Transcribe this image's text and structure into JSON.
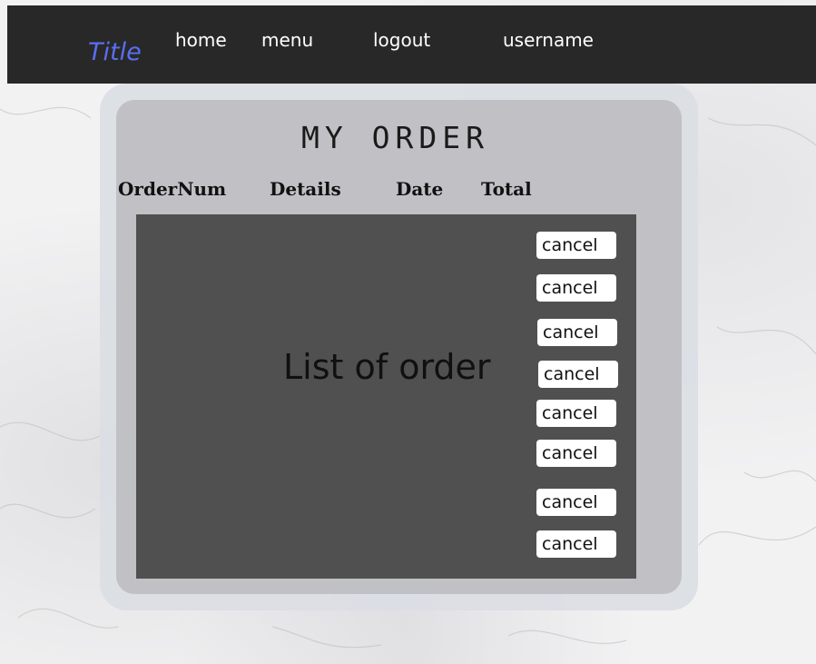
{
  "navbar": {
    "brand": "Title",
    "links": [
      "home",
      "menu",
      "logout",
      "username"
    ]
  },
  "panel": {
    "title": "MY ORDER",
    "columns": [
      "OrderNum",
      "Details",
      "Date",
      "Total"
    ],
    "list_placeholder": "List of order",
    "cancel_buttons": [
      "cancel",
      "cancel",
      "cancel",
      "cancel",
      "cancel",
      "cancel",
      "cancel",
      "cancel"
    ]
  },
  "colors": {
    "navbar_bg": "#282828",
    "brand": "#5a6ef0",
    "list_bg": "#505050"
  }
}
